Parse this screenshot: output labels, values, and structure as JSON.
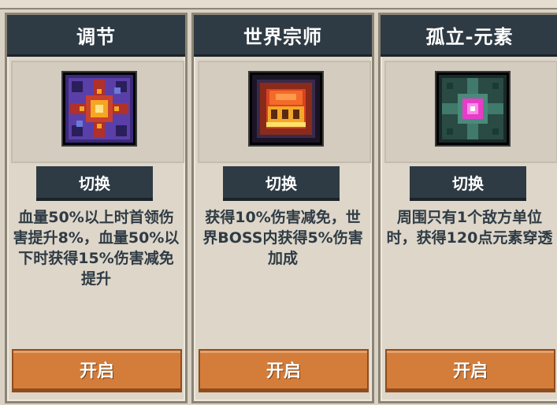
{
  "panels": [
    {
      "title": "调节",
      "icon": "radiant-core-icon",
      "switch_label": "切换",
      "description": "血量50%以上时首领伤害提升8%，血量50%以下时获得15%伤害减免提升",
      "open_label": "开启",
      "colors": {
        "frame": "#4a2f8a",
        "glow": "#f5a623"
      }
    },
    {
      "title": "世界宗师",
      "icon": "golden-crown-icon",
      "switch_label": "切换",
      "description": "获得10%伤害减免，世界BOSS内获得5%伤害加成",
      "open_label": "开启",
      "colors": {
        "frame": "#2a1f3a",
        "glow": "#f39c2a"
      }
    },
    {
      "title": "孤立-元素",
      "icon": "element-gem-icon",
      "switch_label": "切换",
      "description": "周围只有1个敌方单位时，获得120点元素穿透",
      "open_label": "开启",
      "colors": {
        "frame": "#1f3a34",
        "glow": "#e83cc8"
      }
    }
  ],
  "theme": {
    "header_bg": "#2f3b44",
    "open_button": "#d47d3a",
    "panel_bg": "#ddd6c9"
  }
}
